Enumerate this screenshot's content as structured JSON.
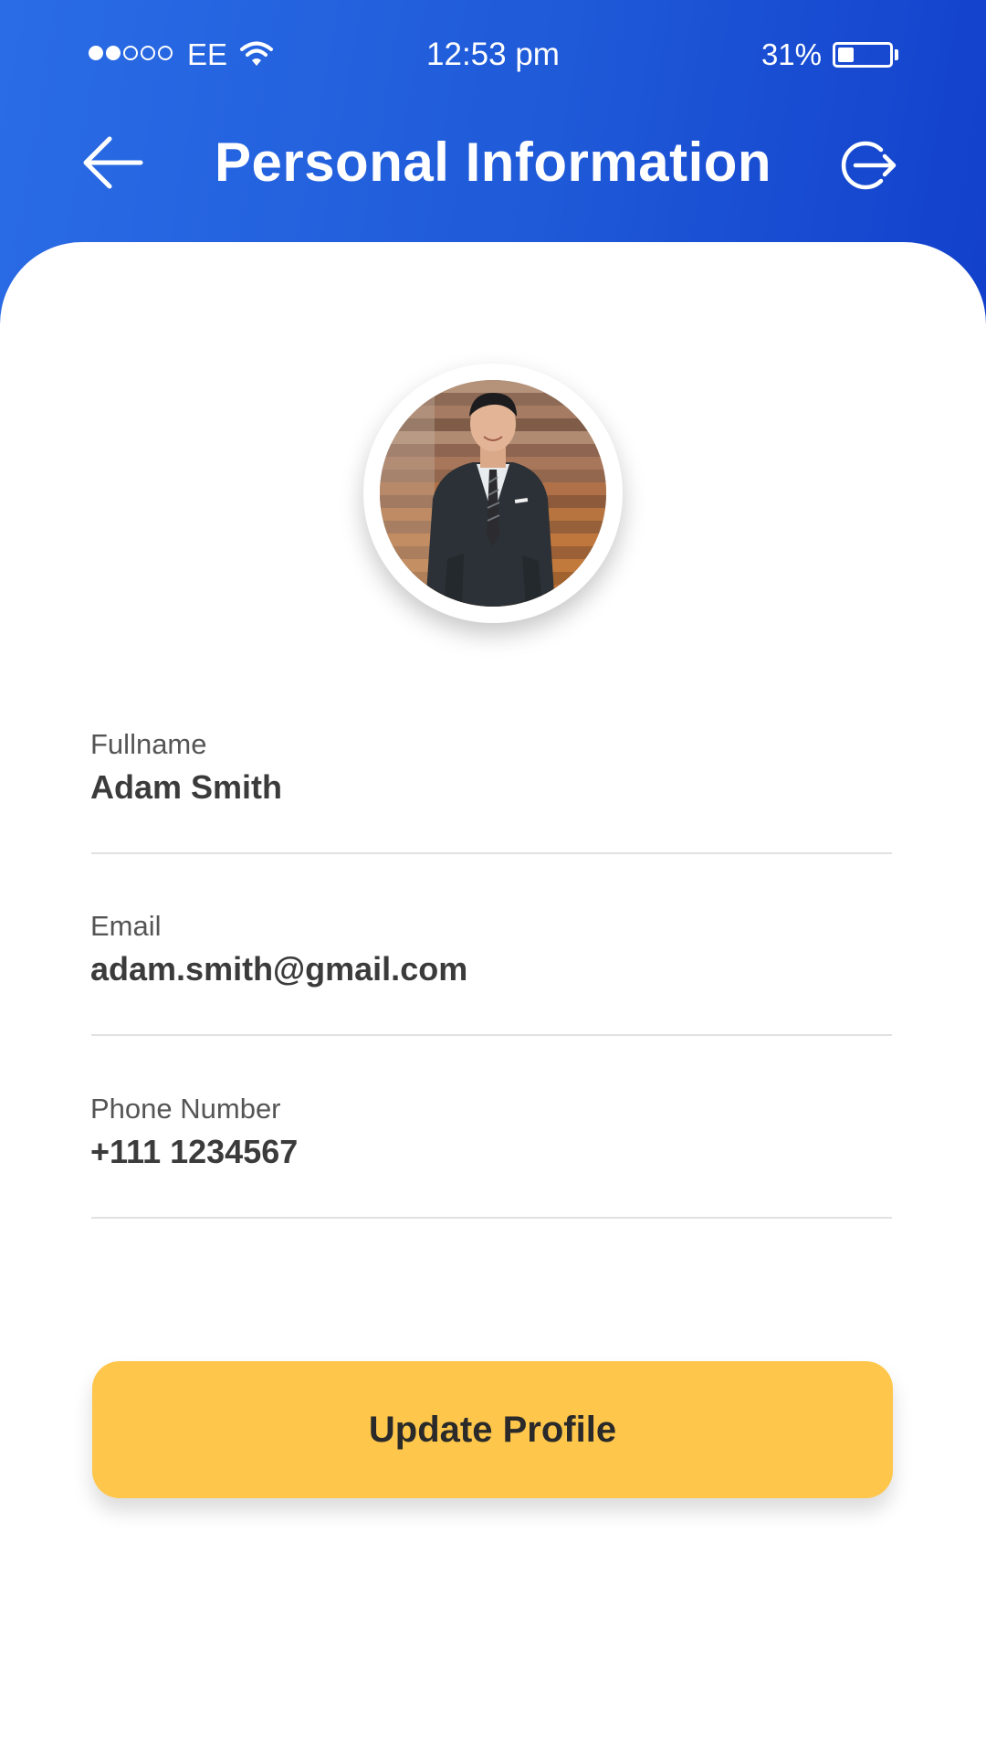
{
  "status_bar": {
    "signal_dots_filled": 2,
    "signal_dots_total": 5,
    "carrier": "EE",
    "wifi_icon": "wifi-icon",
    "time": "12:53  pm",
    "battery_percent": "31%",
    "battery_level": 0.31
  },
  "header": {
    "title": "Personal Information",
    "back_icon": "arrow-left-icon",
    "logout_icon": "logout-icon"
  },
  "profile": {
    "avatar": "profile-photo"
  },
  "fields": [
    {
      "label": "Fullname",
      "value": "Adam Smith"
    },
    {
      "label": "Email",
      "value": "adam.smith@gmail.com"
    },
    {
      "label": "Phone Number",
      "value": "+111 1234567"
    }
  ],
  "actions": {
    "update_label": "Update Profile"
  },
  "colors": {
    "header_gradient_start": "#2a6ce6",
    "header_gradient_end": "#1240cc",
    "accent_button": "#fec64a",
    "text_primary": "#3b3b3b",
    "text_label": "#555555",
    "divider": "#e1e1e1"
  }
}
